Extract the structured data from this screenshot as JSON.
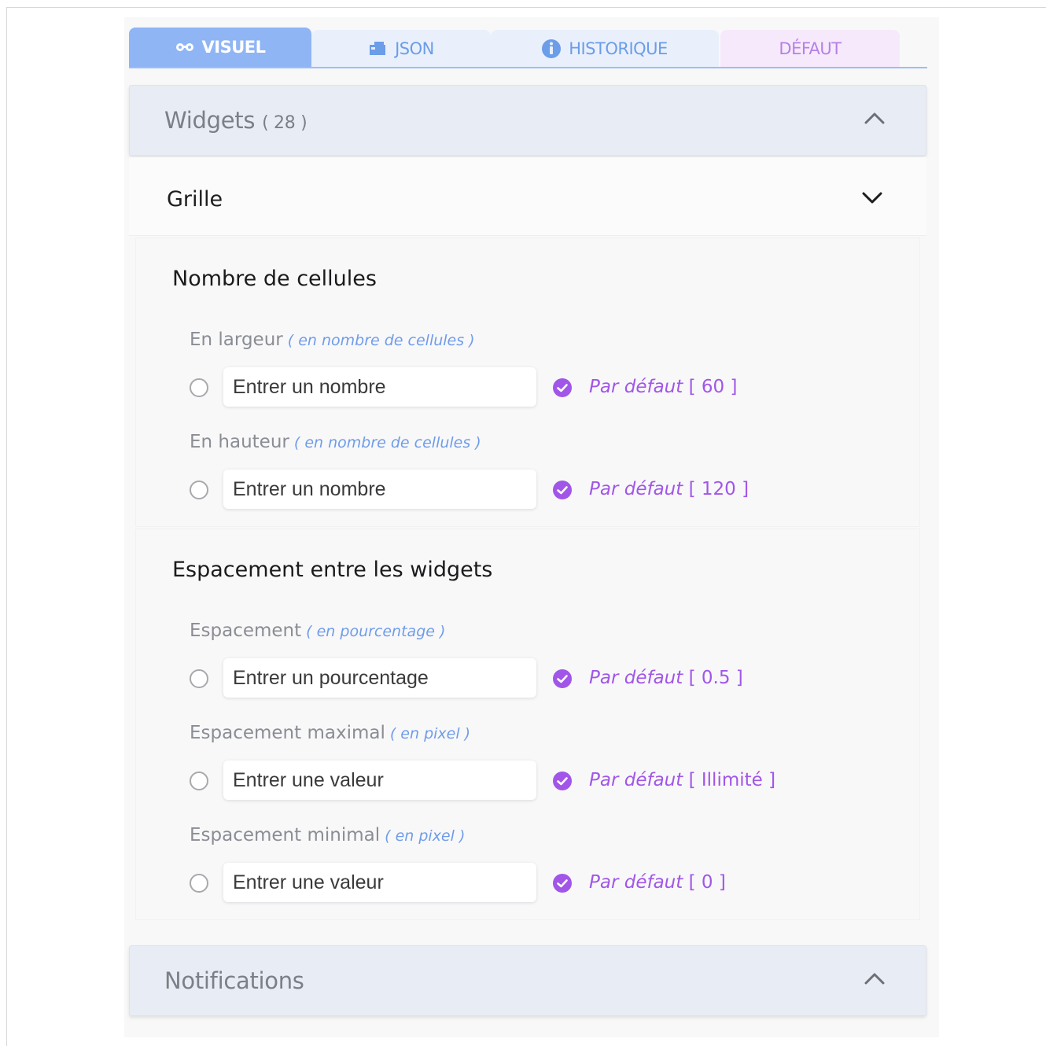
{
  "tabs": [
    {
      "label": "VISUEL",
      "icon": "glasses-icon"
    },
    {
      "label": "JSON",
      "icon": "json-block-icon"
    },
    {
      "label": "HISTORIQUE",
      "icon": "info-icon"
    },
    {
      "label": "DÉFAUT"
    }
  ],
  "widgets_header": {
    "title": "Widgets",
    "count": "( 28 )"
  },
  "grille": {
    "title": "Grille"
  },
  "sections": {
    "cellules": {
      "title": "Nombre de cellules",
      "fields": [
        {
          "label": "En largeur",
          "hint": "( en nombre de cellules )",
          "placeholder": "Entrer un nombre",
          "default_label": "Par défaut",
          "default_value": " [ 60 ]"
        },
        {
          "label": "En hauteur",
          "hint": "( en nombre de cellules )",
          "placeholder": "Entrer un nombre",
          "default_label": "Par défaut",
          "default_value": " [ 120 ]"
        }
      ]
    },
    "espacement": {
      "title": "Espacement entre les widgets",
      "fields": [
        {
          "label": "Espacement",
          "hint": "( en pourcentage )",
          "placeholder": "Entrer un pourcentage",
          "default_label": "Par défaut",
          "default_value": " [ 0.5 ]"
        },
        {
          "label": "Espacement maximal",
          "hint": "( en pixel )",
          "placeholder": "Entrer une valeur",
          "default_label": "Par défaut",
          "default_value": " [ Illimité ]"
        },
        {
          "label": "Espacement minimal",
          "hint": "( en pixel )",
          "placeholder": "Entrer une valeur",
          "default_label": "Par défaut",
          "default_value": " [ 0 ]"
        }
      ]
    }
  },
  "notifications_header": {
    "title": "Notifications"
  },
  "colors": {
    "tab_active": "#8fb5f5",
    "accent_blue": "#6f9ce9",
    "accent_purple": "#a156e8"
  }
}
